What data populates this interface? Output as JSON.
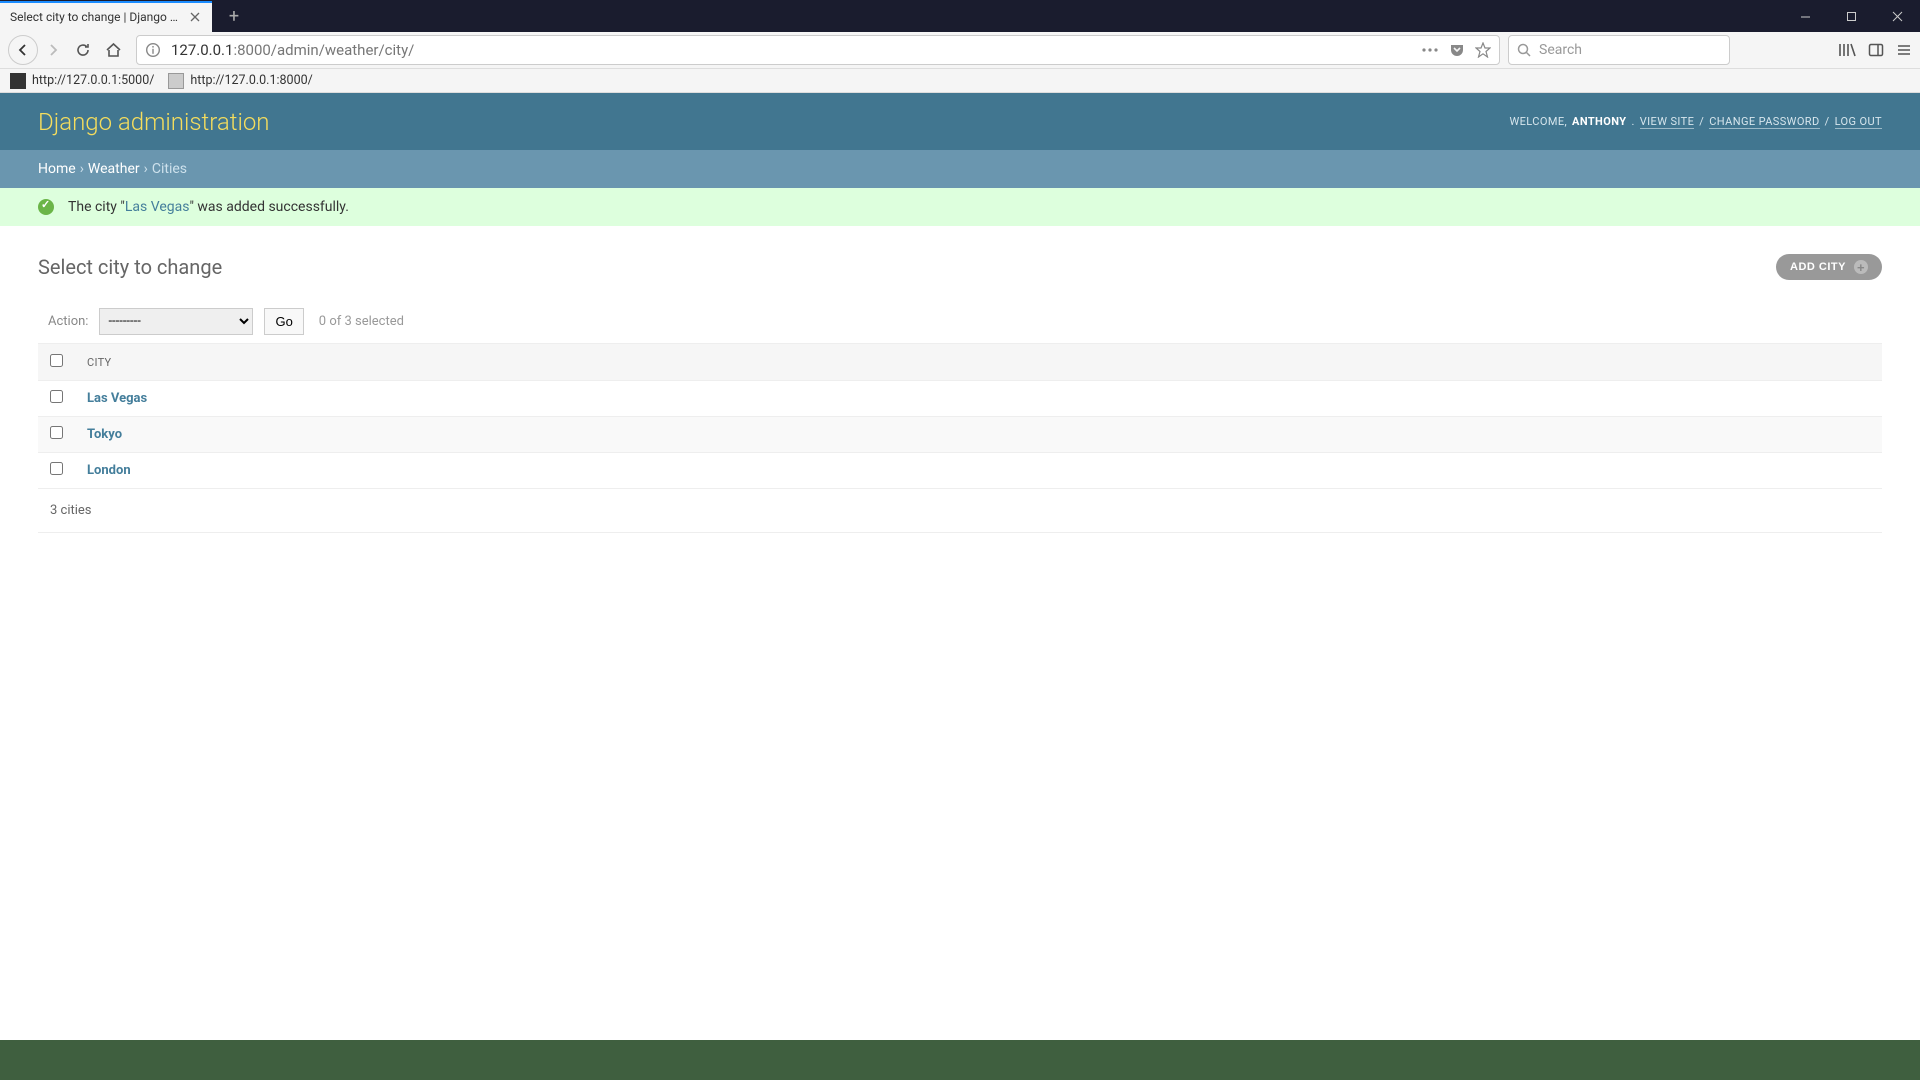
{
  "browser": {
    "tab_title": "Select city to change | Django site a",
    "url_host": "127.0.0.1",
    "url_port_path": ":8000/admin/weather/city/",
    "search_placeholder": "Search",
    "bookmarks": [
      {
        "label": "http://127.0.0.1:5000/"
      },
      {
        "label": "http://127.0.0.1:8000/"
      }
    ]
  },
  "header": {
    "site_title": "Django administration",
    "welcome": "WELCOME,",
    "username": "ANTHONY",
    "view_site": "VIEW SITE",
    "change_password": "CHANGE PASSWORD",
    "log_out": "LOG OUT"
  },
  "breadcrumb": {
    "home": "Home",
    "app": "Weather",
    "current": "Cities"
  },
  "message": {
    "prefix": "The city \"",
    "link": "Las Vegas",
    "suffix": "\" was added successfully."
  },
  "page": {
    "heading": "Select city to change",
    "add_label": "ADD CITY",
    "action_label": "Action:",
    "action_placeholder": "---------",
    "go_label": "Go",
    "selection_count": "0 of 3 selected",
    "column_header": "CITY",
    "rows": [
      {
        "name": "Las Vegas"
      },
      {
        "name": "Tokyo"
      },
      {
        "name": "London"
      }
    ],
    "count_text": "3 cities"
  }
}
